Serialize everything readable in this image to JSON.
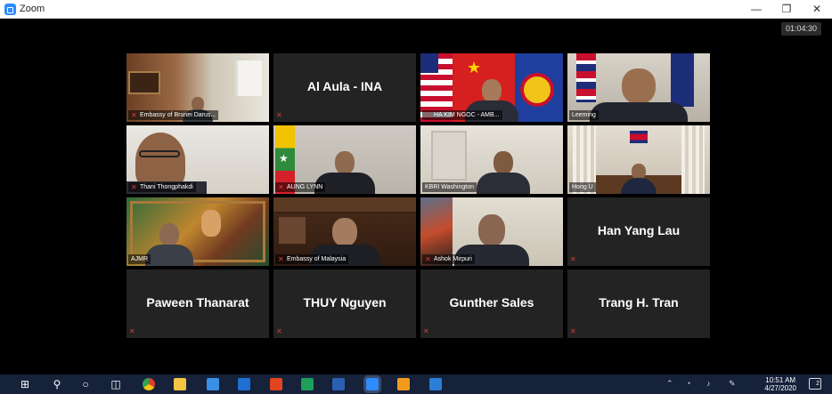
{
  "window": {
    "title": "Zoom"
  },
  "meeting": {
    "timer": "01:04:30"
  },
  "tiles": [
    {
      "name": "Embassy of Brunei Darus...",
      "type": "video"
    },
    {
      "name": "Al Aula - INA",
      "type": "name-only"
    },
    {
      "name": "HA KIM NGOC - AMB...",
      "type": "video"
    },
    {
      "name": "Leeming",
      "type": "video",
      "active": true
    },
    {
      "name": "Thani Thongphakdi",
      "type": "video"
    },
    {
      "name": "AUNG LYNN",
      "type": "video"
    },
    {
      "name": "KBRI Washington",
      "type": "video"
    },
    {
      "name": "Hong U",
      "type": "video"
    },
    {
      "name": "AJMR",
      "type": "video"
    },
    {
      "name": "Embassy of Malaysia",
      "type": "video"
    },
    {
      "name": "Ashok Mirpuri",
      "type": "video"
    },
    {
      "name": "Han Yang Lau",
      "type": "name-only"
    },
    {
      "name": "Paween Thanarat",
      "type": "name-only"
    },
    {
      "name": "THUY Nguyen",
      "type": "name-only"
    },
    {
      "name": "Gunther Sales",
      "type": "name-only"
    },
    {
      "name": "Trang H. Tran",
      "type": "name-only"
    }
  ],
  "taskbar": {
    "time": "10:51 AM",
    "date": "4/27/2020",
    "notification_count": "2",
    "icons": [
      "windows-start-icon",
      "search-icon",
      "cortana-icon",
      "task-view-icon",
      "chrome-icon",
      "file-explorer-icon",
      "store-icon",
      "mail-icon",
      "office-icon",
      "security-icon",
      "word-icon",
      "zoom-icon",
      "snip-icon",
      "photos-icon"
    ]
  }
}
